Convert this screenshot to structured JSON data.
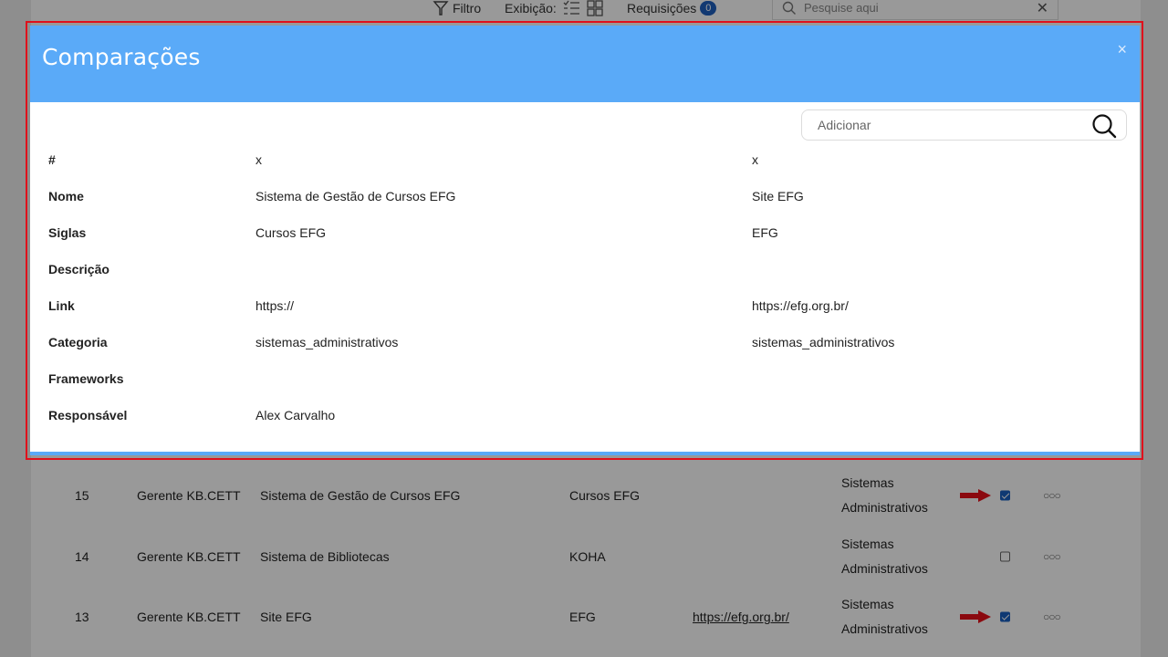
{
  "topbar": {
    "filter_label": "Filtro",
    "view_label": "Exibição:",
    "requests_label": "Requisições",
    "requests_count": "0",
    "search_placeholder": "Pesquise aqui"
  },
  "table_rows": [
    {
      "id": "15",
      "gerente": "Gerente KB.CETT",
      "nome": "Sistema de Gestão de Cursos EFG",
      "sigla": "Cursos EFG",
      "link": "",
      "cat1": "Sistemas",
      "cat2": "Administrativos",
      "checked": true,
      "arrow": true
    },
    {
      "id": "14",
      "gerente": "Gerente KB.CETT",
      "nome": "Sistema de Bibliotecas",
      "sigla": "KOHA",
      "link": "",
      "cat1": "Sistemas",
      "cat2": "Administrativos",
      "checked": false,
      "arrow": false
    },
    {
      "id": "13",
      "gerente": "Gerente KB.CETT",
      "nome": "Site EFG",
      "sigla": "EFG",
      "link": "https://efg.org.br/",
      "cat1": "Sistemas",
      "cat2": "Administrativos",
      "checked": true,
      "arrow": true
    }
  ],
  "modal": {
    "title": "Comparações",
    "close": "×",
    "add_placeholder": "Adicionar",
    "rows": [
      {
        "label": "#",
        "v1": "x",
        "v2": "x"
      },
      {
        "label": "Nome",
        "v1": "Sistema de Gestão de Cursos EFG",
        "v2": "Site EFG"
      },
      {
        "label": "Siglas",
        "v1": "Cursos EFG",
        "v2": "EFG"
      },
      {
        "label": "Descrição",
        "v1": "",
        "v2": ""
      },
      {
        "label": "Link",
        "v1": "https://",
        "v2": "https://efg.org.br/"
      },
      {
        "label": "Categoria",
        "v1": "sistemas_administrativos",
        "v2": "sistemas_administrativos"
      },
      {
        "label": "Frameworks",
        "v1": "",
        "v2": ""
      },
      {
        "label": "Responsável",
        "v1": "Alex Carvalho",
        "v2": ""
      }
    ]
  },
  "colors": {
    "header_blue": "#5aaaf8",
    "highlight_red": "#e0101b",
    "checkbox_blue": "#1a5fc0",
    "arrow_red": "#e8101a"
  }
}
